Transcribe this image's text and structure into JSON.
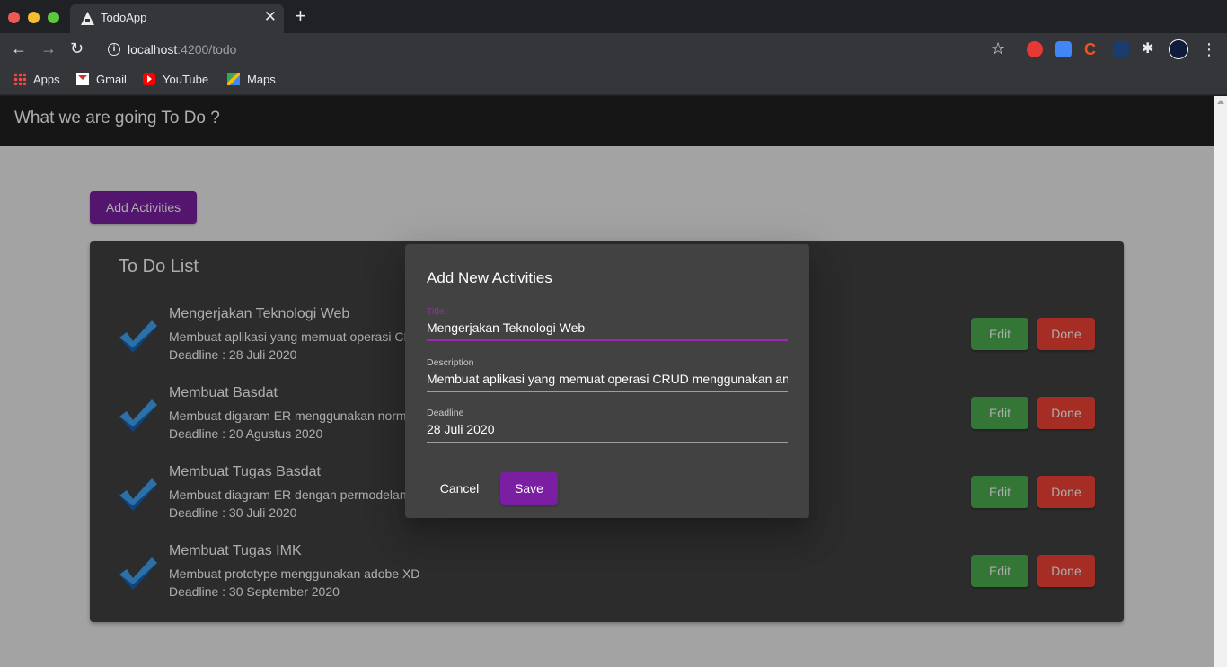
{
  "browser": {
    "tab_title": "TodoApp",
    "url_host": "localhost",
    "url_path": ":4200/todo",
    "new_tab_glyph": "+",
    "close_glyph": "✕",
    "bookmarks": [
      {
        "label": "Apps",
        "icon": "apps-icon"
      },
      {
        "label": "Gmail",
        "icon": "gmail-icon"
      },
      {
        "label": "YouTube",
        "icon": "youtube-icon"
      },
      {
        "label": "Maps",
        "icon": "maps-icon"
      }
    ]
  },
  "app": {
    "header_title": "What we are going To Do ?",
    "add_button_label": "Add Activities",
    "list_title": "To Do List",
    "edit_label": "Edit",
    "done_label": "Done",
    "todos": [
      {
        "name": "Mengerjakan Teknologi Web",
        "description": "Membuat aplikasi yang memuat operasi CRUD menggunakan angular",
        "deadline": "Deadline : 28 Juli 2020"
      },
      {
        "name": "Membuat Basdat",
        "description": "Membuat digaram ER menggunakan normalisasi",
        "deadline": "Deadline : 20 Agustus 2020"
      },
      {
        "name": "Membuat Tugas Basdat",
        "description": "Membuat diagram ER dengan permodelan data",
        "deadline": "Deadline : 30 Juli 2020"
      },
      {
        "name": "Membuat Tugas IMK",
        "description": "Membuat prototype menggunakan adobe XD",
        "deadline": "Deadline : 30 September 2020"
      }
    ]
  },
  "dialog": {
    "title": "Add New Activities",
    "name_label": "Title",
    "name_value": "Mengerjakan Teknologi Web",
    "description_label": "Description",
    "description_value": "Membuat aplikasi yang memuat operasi CRUD menggunakan angular",
    "deadline_label": "Deadline",
    "deadline_value": "28 Juli 2020",
    "cancel_label": "Cancel",
    "save_label": "Save"
  },
  "colors": {
    "primary": "#7b1fa2",
    "edit": "#4caf50",
    "done": "#f44336",
    "check_light": "#42a5f5",
    "check_dark": "#1565c0"
  }
}
